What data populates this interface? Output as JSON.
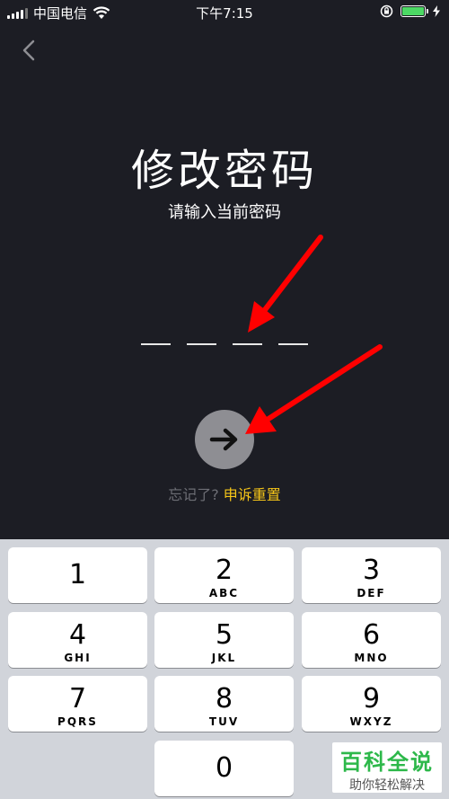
{
  "status_bar": {
    "carrier": "中国电信",
    "time": "下午7:15"
  },
  "page": {
    "title": "修改密码",
    "subtitle": "请输入当前密码",
    "forgot_prefix": "忘记了?",
    "forgot_link": "申诉重置"
  },
  "pin": {
    "length": 4
  },
  "keypad": [
    {
      "num": "1",
      "letters": ""
    },
    {
      "num": "2",
      "letters": "ABC"
    },
    {
      "num": "3",
      "letters": "DEF"
    },
    {
      "num": "4",
      "letters": "GHI"
    },
    {
      "num": "5",
      "letters": "JKL"
    },
    {
      "num": "6",
      "letters": "MNO"
    },
    {
      "num": "7",
      "letters": "PQRS"
    },
    {
      "num": "8",
      "letters": "TUV"
    },
    {
      "num": "9",
      "letters": "WXYZ"
    },
    {
      "num": "0",
      "letters": ""
    }
  ],
  "watermark": {
    "title": "百科全说",
    "subtitle": "助你轻松解决"
  },
  "colors": {
    "background": "#1c1d24",
    "accent": "#f5c518",
    "annotation": "#ff0000",
    "battery": "#4cd964"
  }
}
